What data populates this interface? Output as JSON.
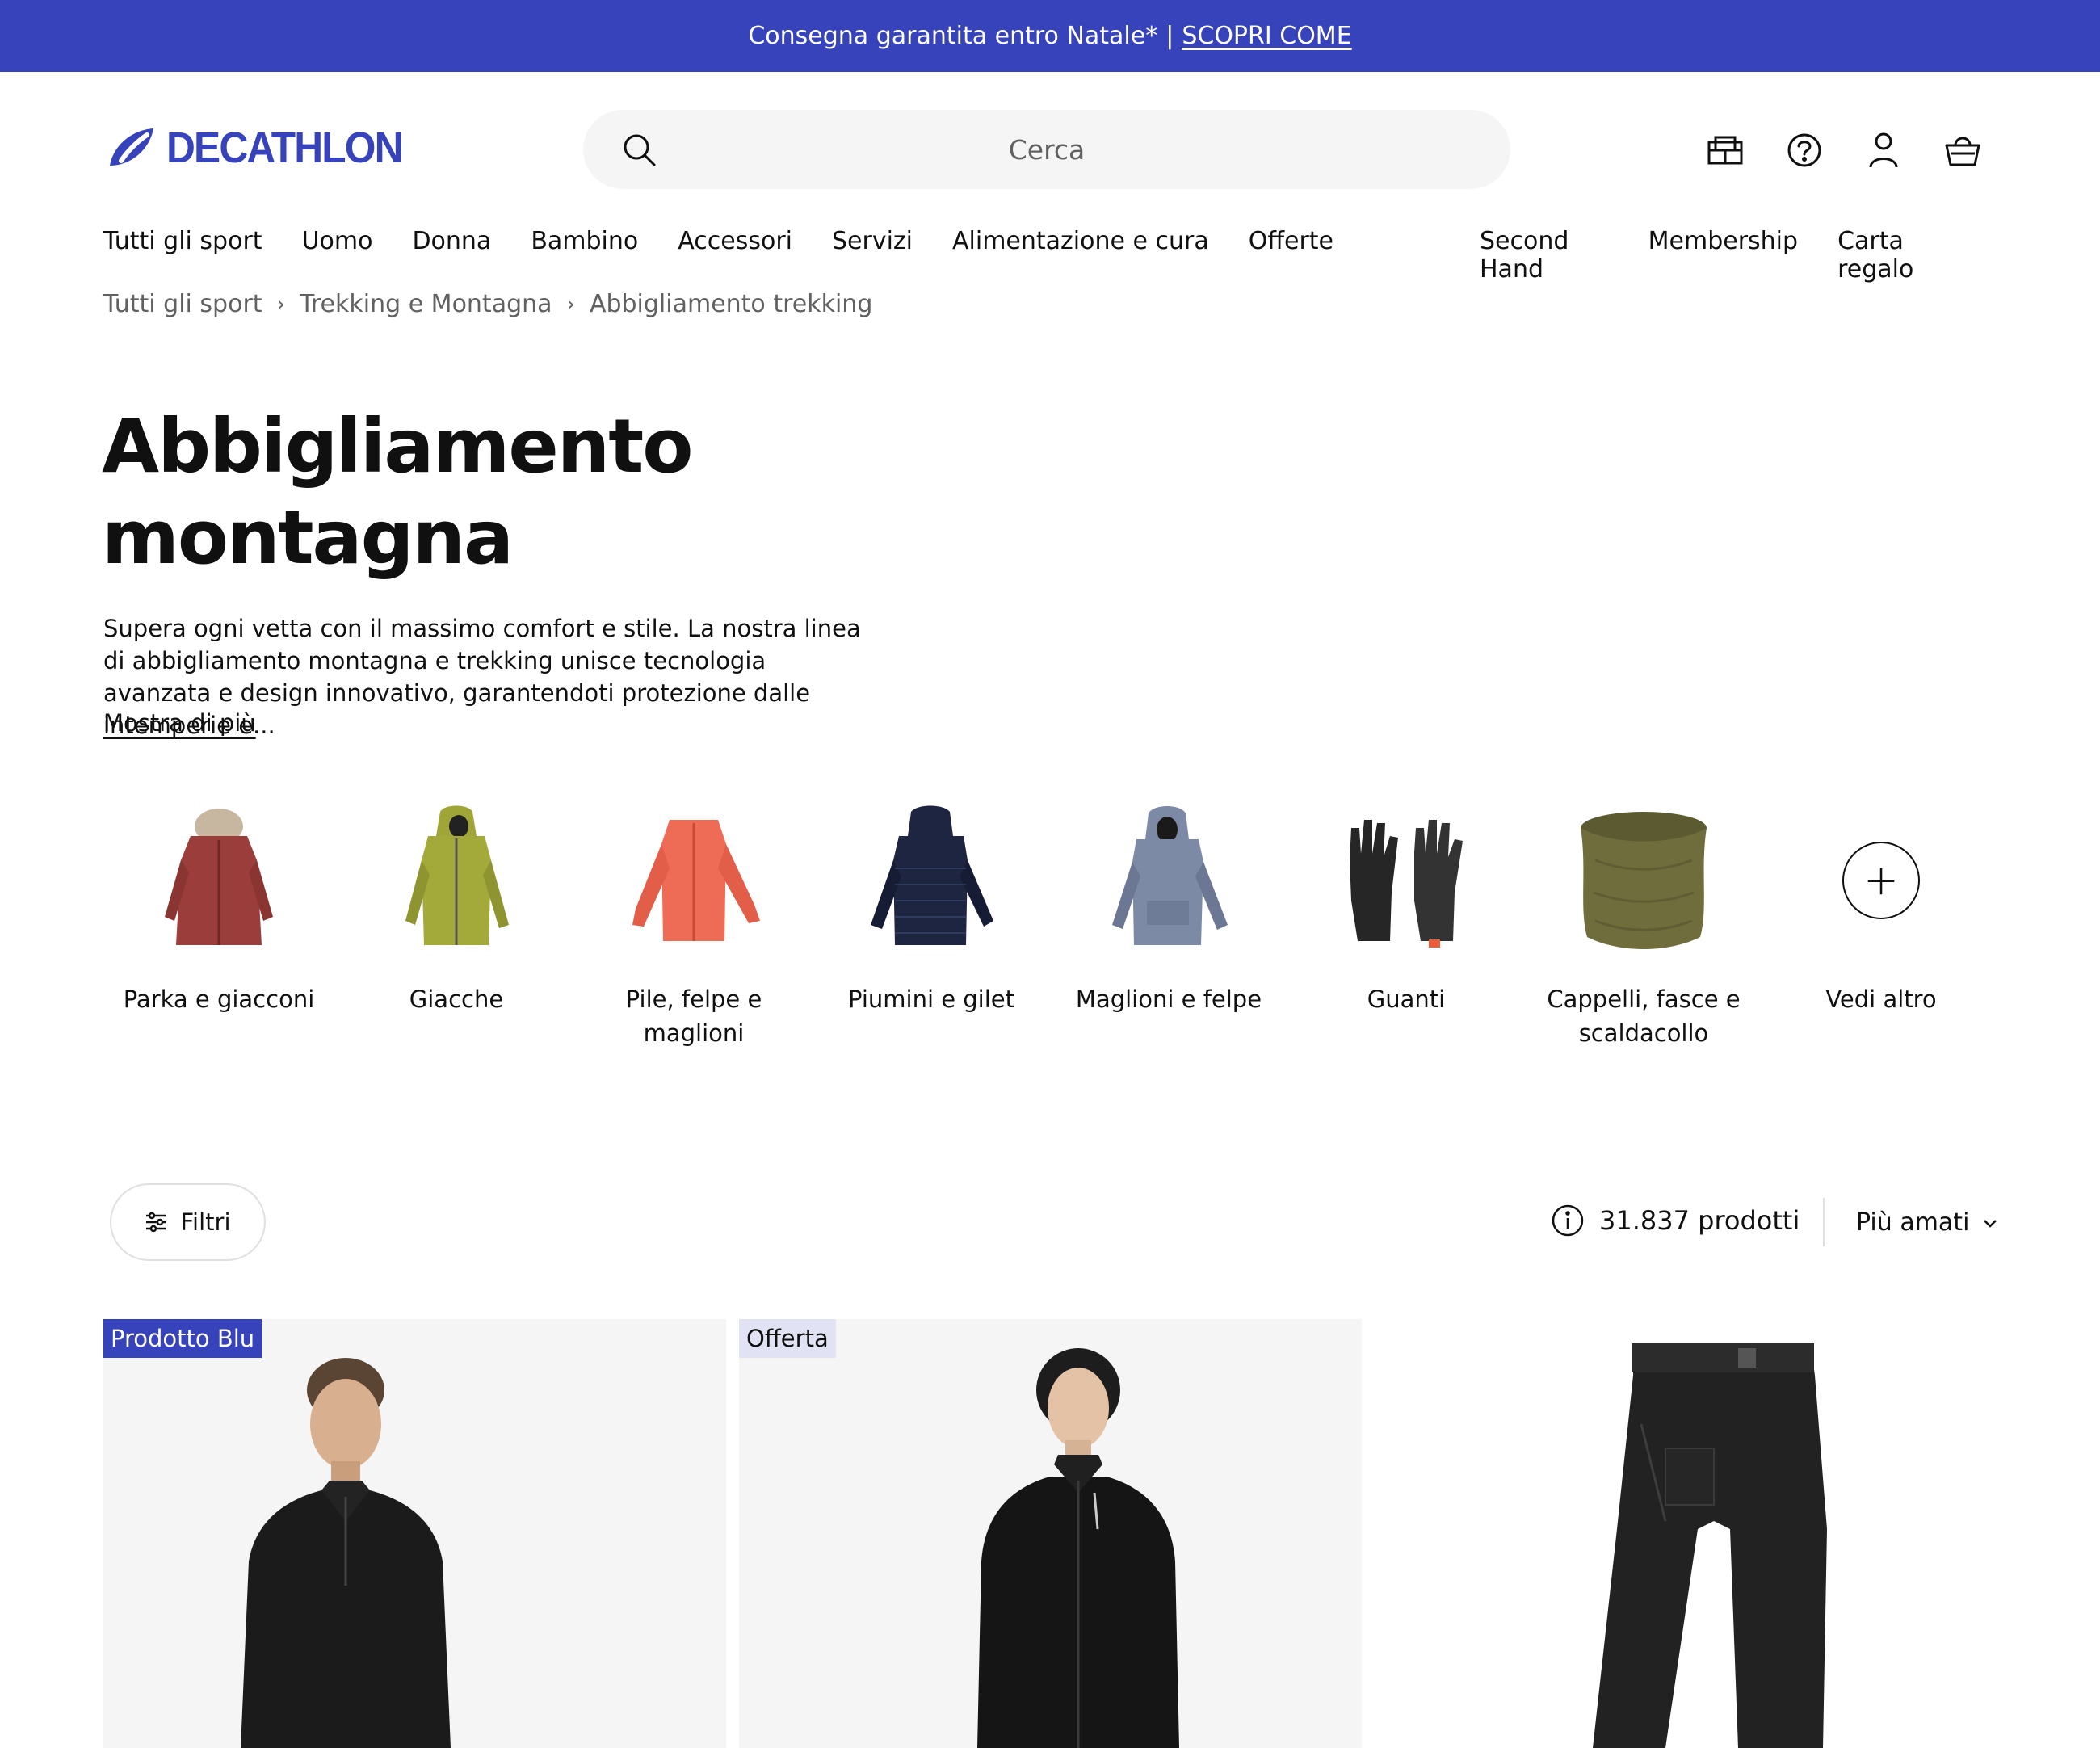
{
  "promo": {
    "text": "Consegna garantita entro Natale*",
    "separator": "|",
    "link": "SCOPRI COME"
  },
  "brand": {
    "name": "DECATHLON",
    "color": "#3643ba"
  },
  "search": {
    "placeholder": "Cerca"
  },
  "header_icons": [
    "store-icon",
    "help-icon",
    "account-icon",
    "cart-icon"
  ],
  "nav": {
    "main": [
      "Tutti gli sport",
      "Uomo",
      "Donna",
      "Bambino",
      "Accessori",
      "Servizi",
      "Alimentazione e cura",
      "Offerte"
    ],
    "secondary": [
      "Second Hand",
      "Membership",
      "Carta regalo"
    ]
  },
  "breadcrumb": [
    "Tutti gli sport",
    "Trekking e Montagna",
    "Abbigliamento trekking"
  ],
  "page": {
    "title": "Abbigliamento montagna",
    "description": "Supera ogni vetta con il massimo comfort e stile. La nostra linea di abbigliamento montagna e trekking unisce tecnologia avanzata e design innovativo, garantendoti protezione dalle intemperie e...",
    "show_more": "Mostra di più"
  },
  "categories": [
    {
      "label": "Parka e giacconi",
      "color": "#9b3d3a"
    },
    {
      "label": "Giacche",
      "color": "#9fa637"
    },
    {
      "label": "Pile, felpe e maglioni",
      "color": "#ee6b55"
    },
    {
      "label": "Piumini e gilet",
      "color": "#1d2540"
    },
    {
      "label": "Maglioni e felpe",
      "color": "#7d8aa5"
    },
    {
      "label": "Guanti",
      "color": "#2a2a2a"
    },
    {
      "label": "Cappelli, fasce e scaldacollo",
      "color": "#6f6d3b"
    },
    {
      "label": "Vedi altro",
      "color": ""
    }
  ],
  "toolbar": {
    "filter_label": "Filtri",
    "count_label": "31.837 prodotti",
    "sort_label": "Più amati"
  },
  "products": [
    {
      "badge": "Prodotto Blu"
    },
    {
      "badge": "Offerta"
    },
    {
      "badge": ""
    }
  ]
}
